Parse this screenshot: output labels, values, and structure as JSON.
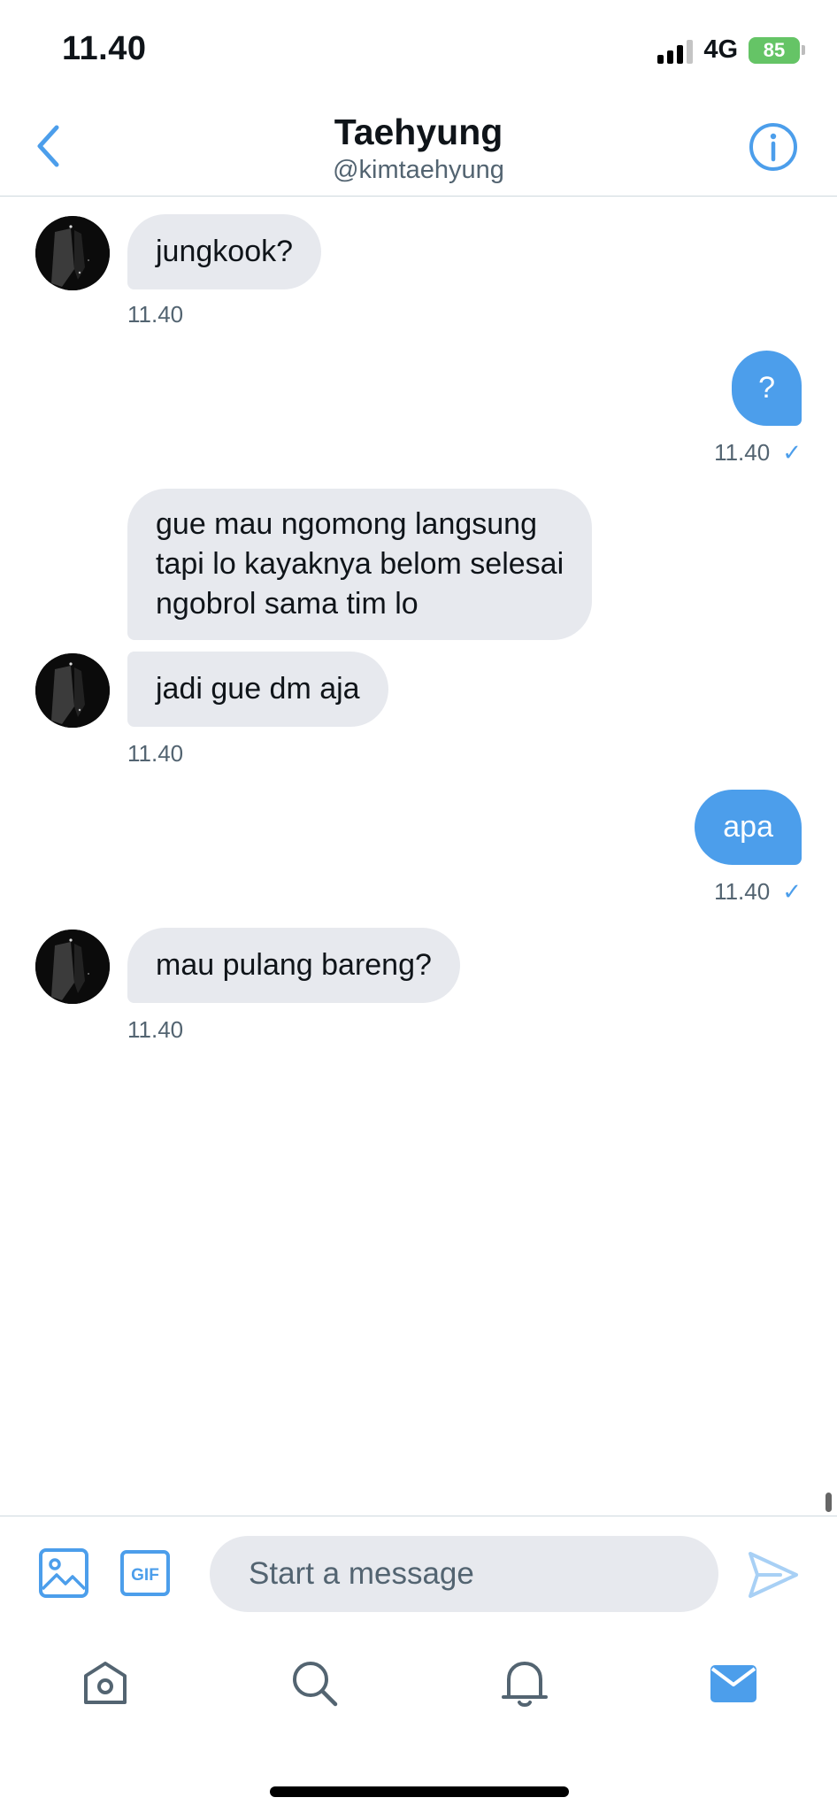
{
  "status_bar": {
    "time": "11.40",
    "network": "4G",
    "battery": "85"
  },
  "header": {
    "name": "Taehyung",
    "handle": "@kimtaehyung"
  },
  "messages": [
    {
      "direction": "in",
      "lines": [
        "jungkook?"
      ],
      "time": "11.40"
    },
    {
      "direction": "out",
      "lines": [
        "?"
      ],
      "time": "11.40"
    },
    {
      "direction": "in",
      "lines": [
        "gue mau ngomong langsung",
        "tapi lo kayaknya belom selesai",
        "ngobrol sama tim lo"
      ]
    },
    {
      "direction": "in",
      "lines": [
        "jadi gue dm aja"
      ],
      "time": "11.40"
    },
    {
      "direction": "out",
      "lines": [
        "apa"
      ],
      "time": "11.40"
    },
    {
      "direction": "in",
      "lines": [
        "mau pulang bareng?"
      ],
      "time": "11.40"
    }
  ],
  "composer": {
    "placeholder": "Start a message",
    "gif_label": "GIF"
  },
  "colors": {
    "accent": "#4c9eeb",
    "incoming_bubble": "#e7e9ee",
    "battery": "#65c466"
  },
  "icons": {
    "back": "chevron-left-icon",
    "info": "info-icon",
    "image": "image-icon",
    "gif": "gif-icon",
    "send": "send-icon",
    "home": "home-icon",
    "search": "search-icon",
    "notifications": "bell-icon",
    "messages": "mail-icon"
  }
}
